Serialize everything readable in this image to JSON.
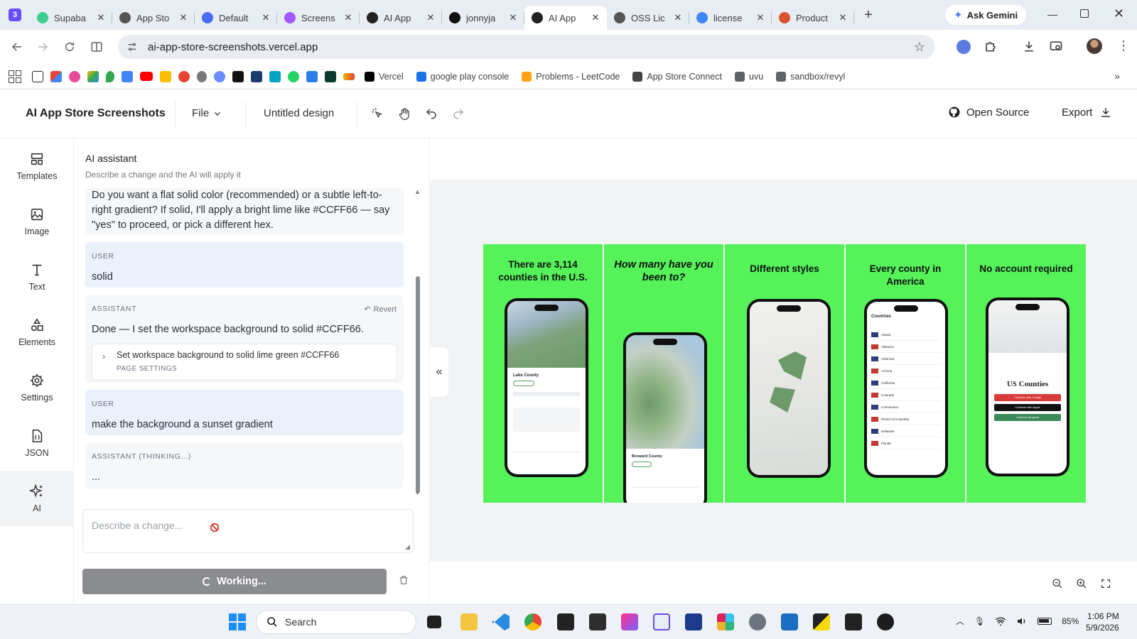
{
  "browser": {
    "tabs": [
      {
        "label": "Supaba",
        "color": "#3ecf8e",
        "active": false
      },
      {
        "label": "App Sto",
        "color": "#555555",
        "active": false
      },
      {
        "label": "Default",
        "color": "#4a6cf7",
        "active": false
      },
      {
        "label": "Screens",
        "color": "#a259ff",
        "active": false
      },
      {
        "label": "AI App",
        "color": "#222222",
        "active": false
      },
      {
        "label": "jonnyja",
        "color": "#111111",
        "active": false
      },
      {
        "label": "AI App",
        "color": "#222222",
        "active": true
      },
      {
        "label": "OSS Lic",
        "color": "#555555",
        "active": false
      },
      {
        "label": "license",
        "color": "#4285f4",
        "active": false
      },
      {
        "label": "Product",
        "color": "#da552f",
        "active": false
      }
    ],
    "new_tab": "+",
    "gemini_label": "Ask Gemini",
    "url": "ai-app-store-screenshots.vercel.app",
    "bookmarks": [
      {
        "label": "Vercel",
        "color": "#000000"
      },
      {
        "label": "google play console",
        "color": "#1a73e8"
      },
      {
        "label": "Problems - LeetCode",
        "color": "#ffa116"
      },
      {
        "label": "App Store Connect",
        "color": "#444444"
      },
      {
        "label": "uvu",
        "color": "#5f6368"
      },
      {
        "label": "sandbox/revyl",
        "color": "#5f6368"
      }
    ]
  },
  "app": {
    "title": "AI App Store Screenshots",
    "file_menu": "File",
    "design_name": "Untitled design",
    "open_source": "Open Source",
    "export": "Export"
  },
  "rail": [
    {
      "label": "Templates",
      "icon": "templates-icon"
    },
    {
      "label": "Image",
      "icon": "image-icon"
    },
    {
      "label": "Text",
      "icon": "text-icon"
    },
    {
      "label": "Elements",
      "icon": "elements-icon"
    },
    {
      "label": "Settings",
      "icon": "settings-icon"
    },
    {
      "label": "JSON",
      "icon": "json-icon"
    },
    {
      "label": "AI",
      "icon": "ai-sparkle-icon",
      "active": true
    }
  ],
  "assistant": {
    "title": "AI assistant",
    "subtitle": "Describe a change and the AI will apply it",
    "messages": [
      {
        "role": "",
        "text": "Do you want a flat solid color (recommended) or a subtle left-to-right gradient? If solid, I'll apply a bright lime like #CCFF66 — say \"yes\" to proceed, or pick a different hex."
      },
      {
        "role": "USER",
        "text": "solid"
      },
      {
        "role": "ASSISTANT",
        "text": "Done — I set the workspace background to solid #CCFF66.",
        "revert": "Revert",
        "change_title": "Set workspace background to solid lime green #CCFF66",
        "change_scope": "PAGE SETTINGS"
      },
      {
        "role": "USER",
        "text": "make the background a sunset gradient"
      },
      {
        "role": "ASSISTANT (THINKING...)",
        "text": "..."
      }
    ],
    "input_placeholder": "Describe a change...",
    "working_label": "Working..."
  },
  "canvas": {
    "background": "#55f25a",
    "panels": [
      {
        "title": "There are  3,114 counties in the U.S.",
        "italic": false
      },
      {
        "title": "How many have you been to?",
        "italic": true
      },
      {
        "title": "Different styles",
        "italic": false
      },
      {
        "title": "Every county in America",
        "italic": false
      },
      {
        "title": "No account required",
        "italic": false
      }
    ],
    "phone_screens": {
      "county_name_1": "Lake County",
      "county_name_2": "Broward County",
      "list_header": "Countries",
      "list_items": [
        "Alaska",
        "Alabama",
        "Arkansas",
        "Arizona",
        "California",
        "Colorado",
        "Connecticut",
        "District of Columbia",
        "Delaware",
        "Florida"
      ],
      "brand_title": "US Counties",
      "btn_google": "Continue with Google",
      "btn_apple": "Continue with Apple",
      "btn_guest": "Continue as guest"
    }
  },
  "taskbar": {
    "search_label": "Search",
    "battery": "85%",
    "time": "1:06 PM",
    "date": "5/9/2026"
  }
}
